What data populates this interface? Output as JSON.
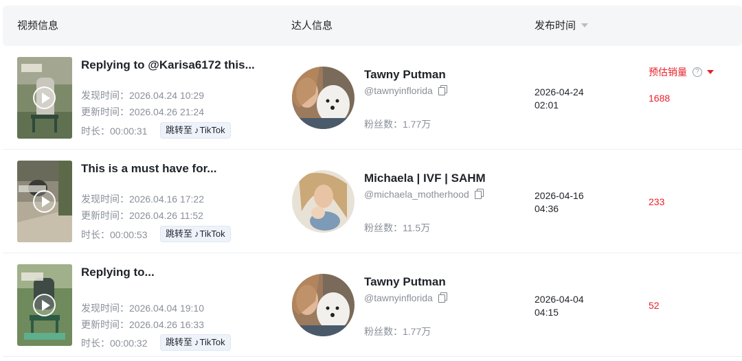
{
  "header": {
    "video_info": "视频信息",
    "creator_info": "达人信息",
    "publish_time": "发布时间",
    "est_sales": "预估销量",
    "help_icon": "?"
  },
  "colors": {
    "accent_red": "#e8202a",
    "header_bg": "#f5f6f8",
    "muted": "#8a8f99"
  },
  "labels": {
    "discovered": "发现时间：",
    "updated": "更新时间：",
    "duration": "时长：",
    "goto_tiktok": "跳转至",
    "tiktok": "TikTok",
    "fans": "粉丝数："
  },
  "rows": [
    {
      "title": "Replying to @Karisa6172 this...",
      "discovered": "2026.04.24 10:29",
      "updated": "2026.04.26 21:24",
      "duration": "00:00:31",
      "creator_name": "Tawny Putman",
      "creator_handle": "@tawnyinflorida",
      "fans": "1.77万",
      "publish_date": "2026-04-24",
      "publish_time": "02:01",
      "sales": "1688"
    },
    {
      "title": "This is a must have for...",
      "discovered": "2026.04.16 17:22",
      "updated": "2026.04.26 11:52",
      "duration": "00:00:53",
      "creator_name": "Michaela | IVF | SAHM",
      "creator_handle": "@michaela_motherhood",
      "fans": "11.5万",
      "publish_date": "2026-04-16",
      "publish_time": "04:36",
      "sales": "233"
    },
    {
      "title": "Replying to...",
      "discovered": "2026.04.04 19:10",
      "updated": "2026.04.26 16:33",
      "duration": "00:00:32",
      "creator_name": "Tawny Putman",
      "creator_handle": "@tawnyinflorida",
      "fans": "1.77万",
      "publish_date": "2026-04-04",
      "publish_time": "04:15",
      "sales": "52"
    }
  ]
}
